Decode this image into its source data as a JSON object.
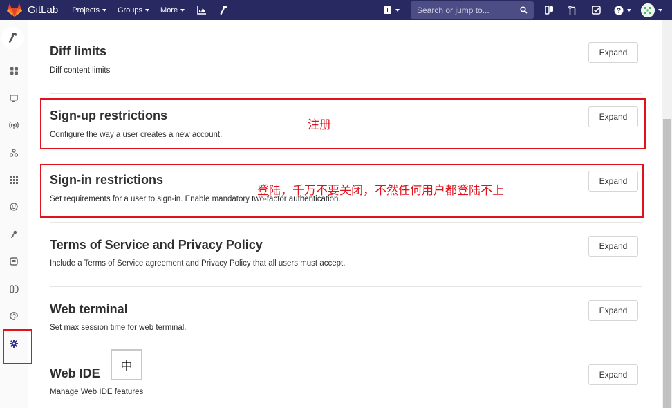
{
  "navbar": {
    "brand": "GitLab",
    "menu": [
      {
        "label": "Projects"
      },
      {
        "label": "Groups"
      },
      {
        "label": "More"
      }
    ],
    "search_placeholder": "Search or jump to..."
  },
  "sections": [
    {
      "title": "Diff limits",
      "desc": "Diff content limits",
      "button": "Expand"
    },
    {
      "title": "Sign-up restrictions",
      "desc": "Configure the way a user creates a new account.",
      "button": "Expand"
    },
    {
      "title": "Sign-in restrictions",
      "desc": "Set requirements for a user to sign-in. Enable mandatory two-factor authentication.",
      "button": "Expand"
    },
    {
      "title": "Terms of Service and Privacy Policy",
      "desc": "Include a Terms of Service agreement and Privacy Policy that all users must accept.",
      "button": "Expand"
    },
    {
      "title": "Web terminal",
      "desc": "Set max session time for web terminal.",
      "button": "Expand"
    },
    {
      "title": "Web IDE",
      "desc": "Manage Web IDE features",
      "button": "Expand"
    }
  ],
  "annotations": {
    "signup": "注册",
    "signin": "登陆，千万不要关闭，不然任何用户都登陆不上"
  },
  "ime": {
    "label": "中"
  },
  "colors": {
    "navbar": "#292961",
    "annotation_red": "#e0121b",
    "logo_orange": "#e24329"
  }
}
